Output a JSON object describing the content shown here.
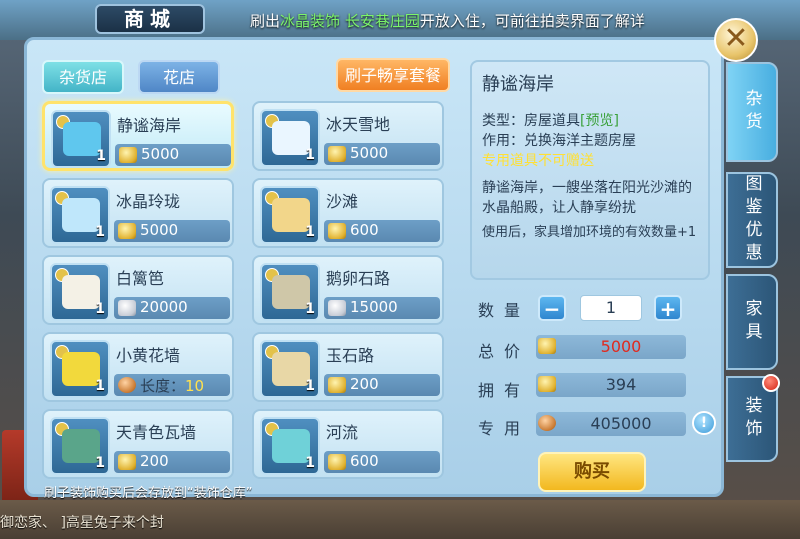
{
  "header": {
    "title": "商城",
    "announcement": {
      "pre": "刷出",
      "hl1": "冰晶装饰",
      "mid": " ",
      "hl2": "长安巷庄园",
      "post": "开放入住，可前往拍卖界面了解详"
    }
  },
  "tabs": {
    "grocery": "杂货店",
    "flower": "花店",
    "skin_pack": "刷子畅享套餐"
  },
  "items": [
    {
      "name": "静谧海岸",
      "qty": "1",
      "price": "5000",
      "currency": "gold",
      "selected": true,
      "art": "#5fc7ee"
    },
    {
      "name": "冰天雪地",
      "qty": "1",
      "price": "5000",
      "currency": "gold",
      "art": "#eaf6ff"
    },
    {
      "name": "冰晶玲珑",
      "qty": "1",
      "price": "5000",
      "currency": "gold",
      "art": "#bfe7fb"
    },
    {
      "name": "沙滩",
      "qty": "1",
      "price": "600",
      "currency": "gold",
      "art": "#f2d68a"
    },
    {
      "name": "白篱笆",
      "qty": "1",
      "price": "20000",
      "currency": "silver",
      "art": "#f4f1e6"
    },
    {
      "name": "鹅卵石路",
      "qty": "1",
      "price": "15000",
      "currency": "silver",
      "art": "#cfc7a8"
    },
    {
      "name": "小黄花墙",
      "qty": "1",
      "price_prefix": "长度：",
      "price": "10",
      "currency": "copper",
      "art": "#f2d93c"
    },
    {
      "name": "玉石路",
      "qty": "1",
      "price": "200",
      "currency": "gold",
      "art": "#e8d7a6"
    },
    {
      "name": "天青色瓦墙",
      "qty": "1",
      "price": "200",
      "currency": "gold",
      "art": "#5aa58a"
    },
    {
      "name": "河流",
      "qty": "1",
      "price": "600",
      "currency": "gold",
      "art": "#6fd1d8"
    }
  ],
  "detail": {
    "title": "静谧海岸",
    "type_label": "类型：",
    "type_value": "房屋道具",
    "preview": "[预览]",
    "use_label": "作用：",
    "use_value": "兑换海洋主题房屋",
    "special": "专用道具不可赠送",
    "desc": "静谧海岸，一艘坐落在阳光沙滩的水晶船殿，让人静享纷扰",
    "effect": "使用后，家具增加环境的有效数量+1"
  },
  "purchase": {
    "qty_label": "数量",
    "qty_value": "1",
    "minus": "−",
    "plus": "+",
    "total_label": "总价",
    "total_value": "5000",
    "own_label": "拥有",
    "own_value": "394",
    "special_label": "专用",
    "special_value": "405000",
    "buy_label": "购买"
  },
  "side_tabs": [
    "杂货",
    "图鉴优惠",
    "家具",
    "装饰"
  ],
  "footer_note": "刷子装饰购买后会存放到“装饰仓库”",
  "chat_line": "御恋家、 ]高星兔子来个封",
  "close_symbol": "✕"
}
